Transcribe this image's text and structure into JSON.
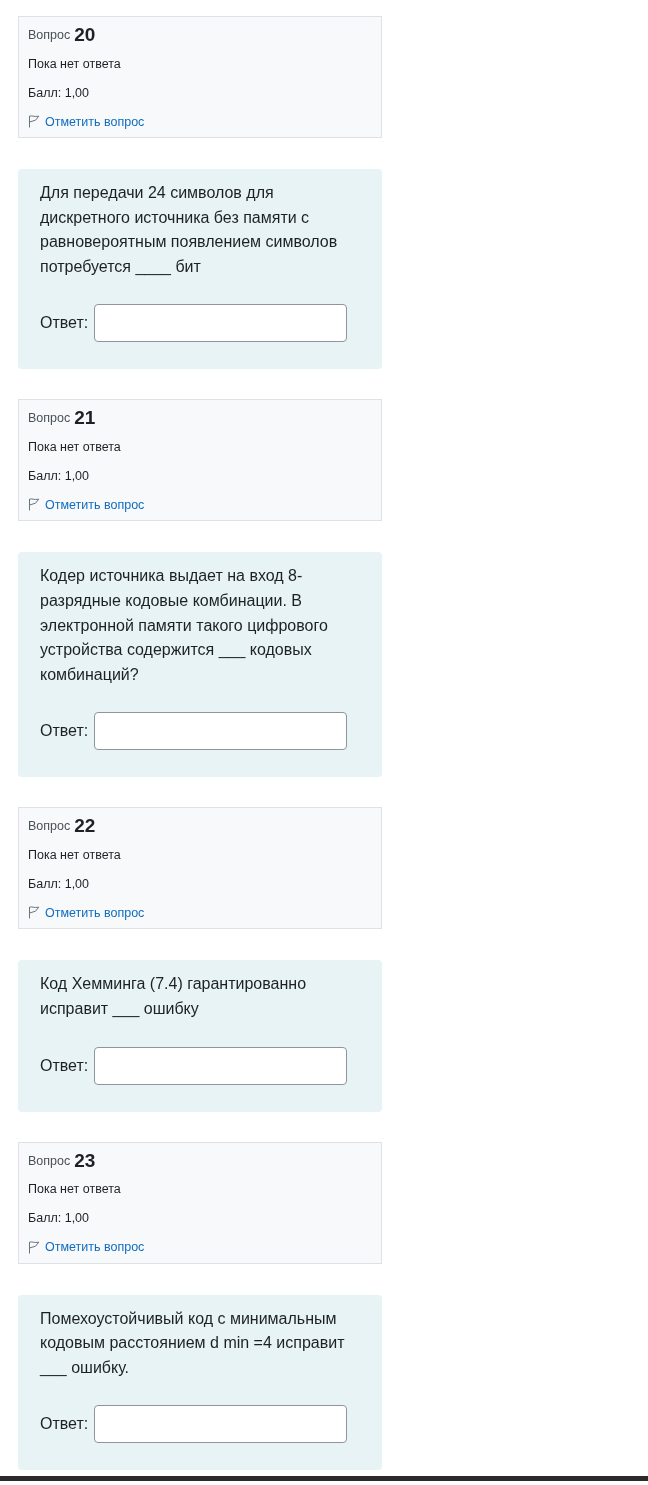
{
  "questions": [
    {
      "number_label": "Вопрос",
      "number": "20",
      "status": "Пока нет ответа",
      "grade": "Балл: 1,00",
      "flag_link": "Отметить вопрос",
      "text": "Для передачи 24 символов для дискретного источника без памяти с равновероятным появлением символов потребуется ____ бит",
      "answer_label": "Ответ:"
    },
    {
      "number_label": "Вопрос",
      "number": "21",
      "status": "Пока нет ответа",
      "grade": "Балл: 1,00",
      "flag_link": "Отметить вопрос",
      "text": "Кодер источника выдает на вход 8-разрядные кодовые комбинации. В электронной памяти такого цифрового устройства содержится ___ кодовых комбинаций?",
      "answer_label": "Ответ:"
    },
    {
      "number_label": "Вопрос",
      "number": "22",
      "status": "Пока нет ответа",
      "grade": "Балл: 1,00",
      "flag_link": "Отметить вопрос",
      "text": "Код Хемминга (7.4) гарантированно исправит ___ ошибку",
      "answer_label": "Ответ:"
    },
    {
      "number_label": "Вопрос",
      "number": "23",
      "status": "Пока нет ответа",
      "grade": "Балл: 1,00",
      "flag_link": "Отметить вопрос",
      "text": "Помехоустойчивый код с минимальным кодовым расстоянием d min =4 исправит ___ ошибку.",
      "answer_label": "Ответ:"
    }
  ]
}
